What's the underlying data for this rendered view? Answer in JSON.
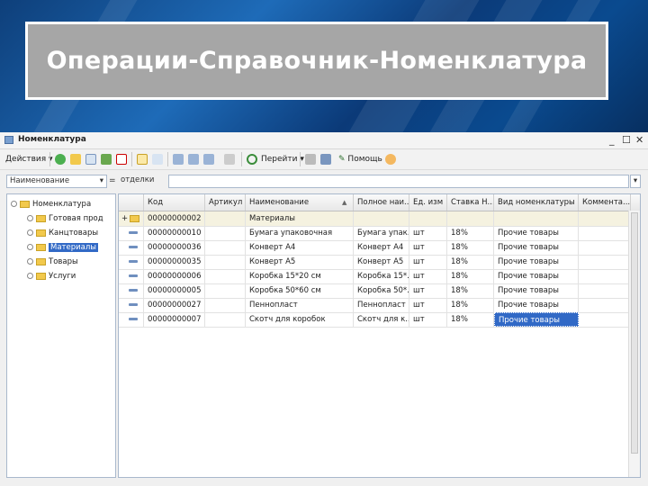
{
  "slide_title": "Операции-Справочник-Номенклатура",
  "window": {
    "title": "Номенклатура",
    "controls": [
      "_",
      "☐",
      "✕"
    ]
  },
  "toolbar": {
    "actions_label": "Действия",
    "goto_label": "Перейти",
    "help_label": "Помощь"
  },
  "filter": {
    "field_value": "Наименование",
    "search_hint": "отделки"
  },
  "tree": {
    "root": "Номенклатура",
    "items": [
      "Готовая прод",
      "Канцтовары",
      "Материалы",
      "Товары",
      "Услуги"
    ],
    "selected": "Материалы"
  },
  "grid": {
    "columns": [
      "Код",
      "Артикул",
      "Наименование",
      "Полное наи...",
      "Ед. изм",
      "Ставка Н...",
      "Вид номенклатуры",
      "Коммента..."
    ],
    "rows": [
      {
        "type": "group",
        "code": "00000000002",
        "article": "",
        "name": "Материалы",
        "full": "",
        "unit": "",
        "vat": "",
        "kind": "",
        "comment": ""
      },
      {
        "type": "item",
        "code": "00000000010",
        "article": "",
        "name": "Бумага упаковочная",
        "full": "Бумага упак...",
        "unit": "шт",
        "vat": "18%",
        "kind": "Прочие товары",
        "comment": ""
      },
      {
        "type": "item",
        "code": "00000000036",
        "article": "",
        "name": "Конверт А4",
        "full": "Конверт А4",
        "unit": "шт",
        "vat": "18%",
        "kind": "Прочие товары",
        "comment": ""
      },
      {
        "type": "item",
        "code": "00000000035",
        "article": "",
        "name": "Конверт А5",
        "full": "Конверт А5",
        "unit": "шт",
        "vat": "18%",
        "kind": "Прочие товары",
        "comment": ""
      },
      {
        "type": "item",
        "code": "00000000006",
        "article": "",
        "name": "Коробка 15*20 см",
        "full": "Коробка 15*...",
        "unit": "шт",
        "vat": "18%",
        "kind": "Прочие товары",
        "comment": ""
      },
      {
        "type": "item",
        "code": "00000000005",
        "article": "",
        "name": "Коробка 50*60 см",
        "full": "Коробка 50*...",
        "unit": "шт",
        "vat": "18%",
        "kind": "Прочие товары",
        "comment": ""
      },
      {
        "type": "item",
        "code": "00000000027",
        "article": "",
        "name": "Пеннопласт",
        "full": "Пеннопласт",
        "unit": "шт",
        "vat": "18%",
        "kind": "Прочие товары",
        "comment": ""
      },
      {
        "type": "item",
        "code": "00000000007",
        "article": "",
        "name": "Скотч для коробок",
        "full": "Скотч для к...",
        "unit": "шт",
        "vat": "18%",
        "kind": "Прочие товары",
        "comment": ""
      }
    ]
  },
  "colors": {
    "selection": "#3169c6",
    "folder": "#f2c94c",
    "background_blue": "#1e6bb8"
  }
}
